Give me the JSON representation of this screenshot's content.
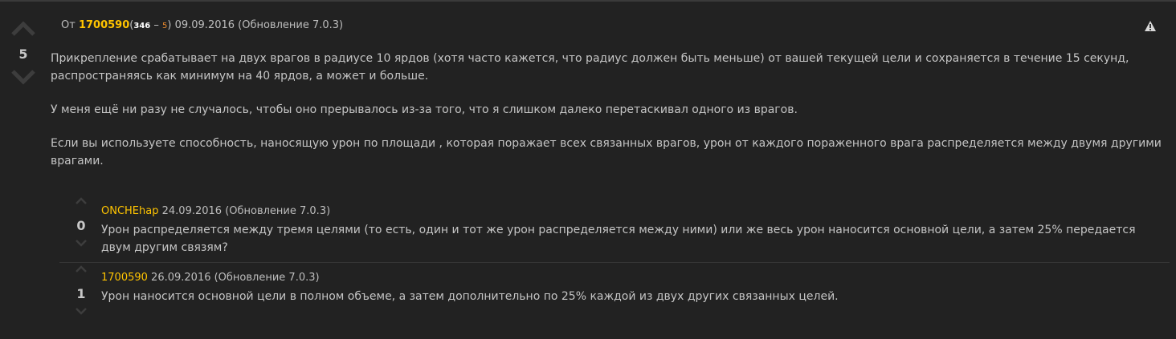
{
  "main_comment": {
    "prefix": "От",
    "author": "1700590",
    "rep_open": "(",
    "rep_positive": "346",
    "rep_sep": " – ",
    "rep_negative": "5",
    "rep_close": ")",
    "date": "09.09.2016 (Обновление 7.0.3)",
    "score": "5",
    "paragraphs": [
      "Прикрепление срабатывает на двух врагов в радиусе 10 ярдов (хотя часто кажется, что радиус должен быть меньше) от вашей текущей цели и сохраняется в течение 15 секунд, распространяясь как минимум на 40 ярдов, а может и больше.",
      "У меня ещё ни разу не случалось, чтобы оно прерывалось из-за того, что я слишком далеко перетаскивал одного из врагов.",
      "Если вы используете способность, наносящую урон по площади , которая поражает всех связанных врагов, урон от каждого пораженного врага распределяется между двумя другими врагами."
    ]
  },
  "replies": [
    {
      "author": "ONCHEhap",
      "date": "24.09.2016 (Обновление 7.0.3)",
      "score": "0",
      "text": "Урон распределяется между тремя целями (то есть, один и тот же урон распределяется между ними) или же весь урон наносится основной цели, а затем 25% передается двум другим связям?"
    },
    {
      "author": "1700590",
      "date": "26.09.2016 (Обновление 7.0.3)",
      "score": "1",
      "text": "Урон наносится основной цели в полном объеме, а затем дополнительно по 25% каждой из двух других связанных целей."
    }
  ],
  "colors": {
    "background": "#222222",
    "author": "#ffc400",
    "rep_negative": "#e8892d"
  }
}
